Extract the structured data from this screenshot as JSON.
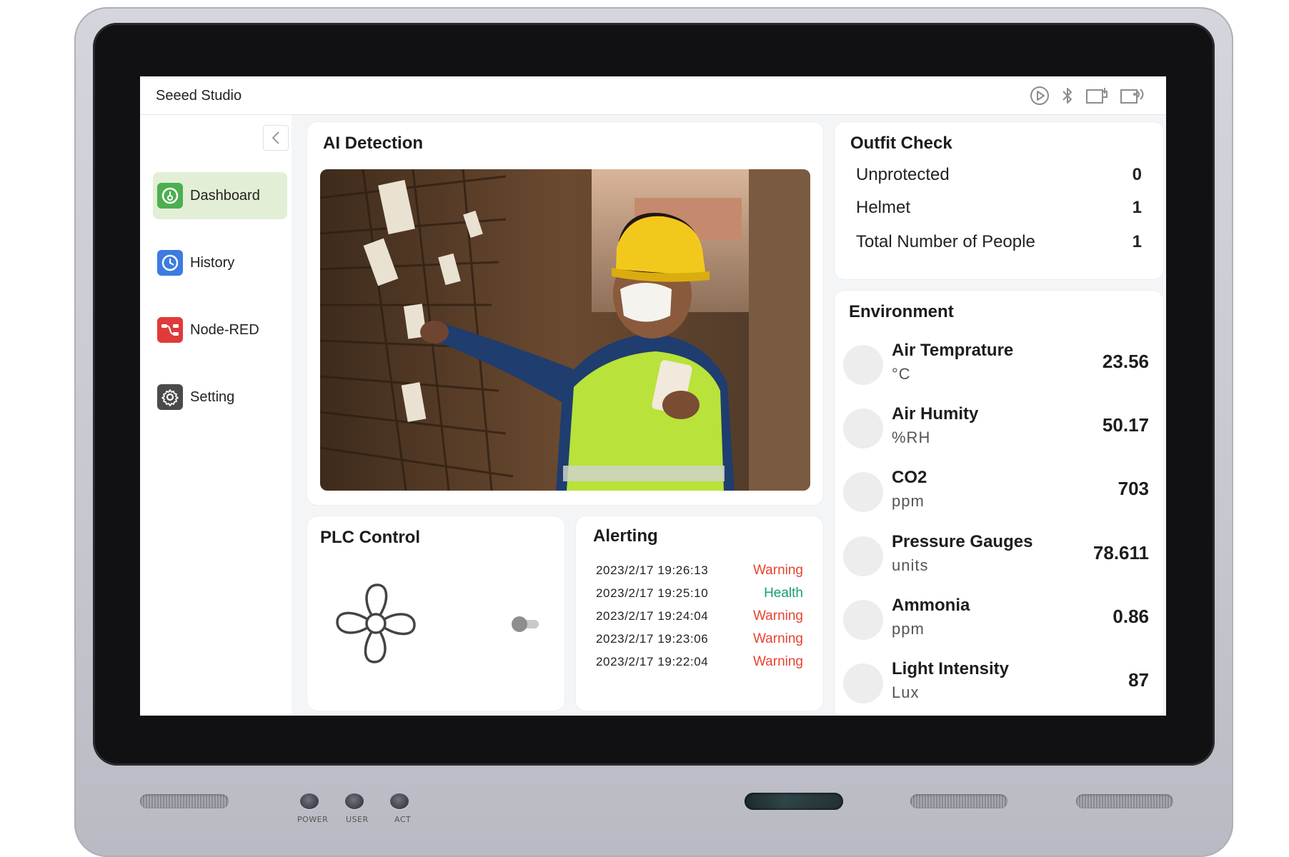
{
  "app": {
    "brand": "Seeed Studio"
  },
  "status_icons": [
    "play-icon",
    "bluetooth-icon",
    "usb-icon",
    "wireless-icon"
  ],
  "sidebar": {
    "items": [
      {
        "label": "Dashboard",
        "icon": "gauge-icon",
        "active": true,
        "color": "#4caf50"
      },
      {
        "label": "History",
        "icon": "clock-icon",
        "active": false,
        "color": "#3d7be0"
      },
      {
        "label": "Node-RED",
        "icon": "node-red-icon",
        "active": false,
        "color": "#e03a3a"
      },
      {
        "label": "Setting",
        "icon": "gear-icon",
        "active": false,
        "color": "#4a4a4a"
      }
    ]
  },
  "ai_detection": {
    "title": "AI Detection"
  },
  "outfit_check": {
    "title": "Outfit Check",
    "rows": [
      {
        "label": "Unprotected",
        "value": "0"
      },
      {
        "label": "Helmet",
        "value": "1"
      },
      {
        "label": "Total Number of People",
        "value": "1"
      }
    ]
  },
  "environment": {
    "title": "Environment",
    "rows": [
      {
        "name": "Air Temprature",
        "unit": "°C",
        "value": "23.56"
      },
      {
        "name": "Air Humity",
        "unit": "%RH",
        "value": "50.17"
      },
      {
        "name": "CO2",
        "unit": "ppm",
        "value": "703"
      },
      {
        "name": "Pressure Gauges",
        "unit": "units",
        "value": "78.611"
      },
      {
        "name": "Ammonia",
        "unit": "ppm",
        "value": "0.86"
      },
      {
        "name": "Light Intensity",
        "unit": "Lux",
        "value": "87"
      }
    ]
  },
  "plc_control": {
    "title": "PLC Control",
    "fan_on": false
  },
  "alerting": {
    "title": "Alerting",
    "colors": {
      "Warning": "#e8432f",
      "Health": "#15a06e"
    },
    "rows": [
      {
        "time": "2023/2/17 19:26:13",
        "status": "Warning"
      },
      {
        "time": "2023/2/17 19:25:10",
        "status": "Health"
      },
      {
        "time": "2023/2/17 19:24:04",
        "status": "Warning"
      },
      {
        "time": "2023/2/17 19:23:06",
        "status": "Warning"
      },
      {
        "time": "2023/2/17 19:22:04",
        "status": "Warning"
      }
    ]
  },
  "hardware": {
    "led_labels": [
      "POWER",
      "USER",
      "ACT"
    ]
  }
}
